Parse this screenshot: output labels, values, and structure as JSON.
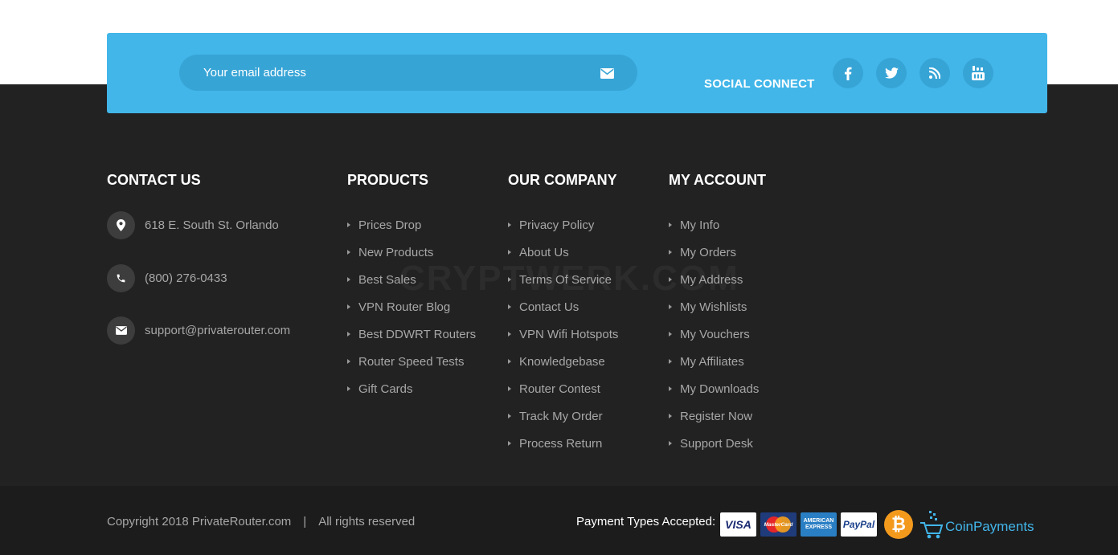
{
  "newsletter": {
    "email_placeholder": "Your email address",
    "send_icon": "envelope-icon",
    "social_label": "SOCIAL CONNECT",
    "social_icons": [
      "facebook-icon",
      "twitter-icon",
      "rss-icon",
      "youtube-icon"
    ],
    "accent_color": "#42b6e9"
  },
  "contact": {
    "title": "CONTACT US",
    "address": "618 E. South St. Orlando",
    "phone": "(800) 276-0433",
    "email": "support@privaterouter.com"
  },
  "products": {
    "title": "PRODUCTS",
    "items": [
      "Prices Drop",
      "New Products",
      "Best Sales",
      "VPN Router Blog",
      "Best DDWRT Routers",
      "Router Speed Tests",
      "Gift Cards"
    ]
  },
  "company": {
    "title": "OUR COMPANY",
    "items": [
      "Privacy Policy",
      "About Us",
      "Terms Of Service",
      "Contact Us",
      "VPN Wifi Hotspots",
      "Knowledgebase",
      "Router Contest",
      "Track My Order",
      "Process Return"
    ]
  },
  "account": {
    "title": "MY ACCOUNT",
    "items": [
      "My Info",
      "My Orders",
      "My Address",
      "My Wishlists",
      "My Vouchers",
      "My Affiliates",
      "My Downloads",
      "Register Now",
      "Support Desk"
    ]
  },
  "watermark": "CRYPTWERK.COM",
  "footer": {
    "copyright": "Copyright 2018 PrivateRouter.com",
    "separator": "|",
    "rights": "All rights reserved",
    "payments_label": "Payment Types Accepted:",
    "cards": {
      "visa": "VISA",
      "mastercard": "MasterCard",
      "amex_1": "AMERICAN",
      "amex_2": "EXPRESS",
      "paypal": "PayPal",
      "bitcoin": "₿",
      "coinpayments": "CoinPayments"
    }
  }
}
